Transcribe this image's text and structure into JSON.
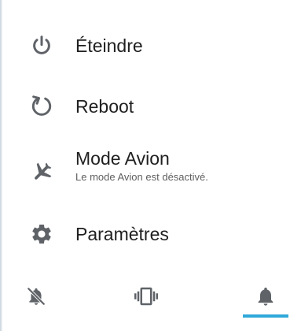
{
  "power_menu": {
    "items": [
      {
        "id": "power",
        "label": "Éteindre",
        "icon": "power-icon"
      },
      {
        "id": "reboot",
        "label": "Reboot",
        "icon": "reboot-icon"
      },
      {
        "id": "airplane",
        "label": "Mode Avion",
        "sublabel": "Le mode Avion est désactivé.",
        "icon": "airplane-icon"
      },
      {
        "id": "settings",
        "label": "Paramètres",
        "icon": "gear-icon"
      }
    ]
  },
  "sound_modes": {
    "options": [
      {
        "id": "mute",
        "icon": "bell-off-icon"
      },
      {
        "id": "vibrate",
        "icon": "vibrate-icon"
      },
      {
        "id": "ring",
        "icon": "bell-icon"
      }
    ],
    "selected": "ring"
  },
  "colors": {
    "icon": "#5f6368",
    "text": "#202020",
    "subtext": "#5f5f5f",
    "accent": "#2fa8d9",
    "background": "#ffffff"
  }
}
